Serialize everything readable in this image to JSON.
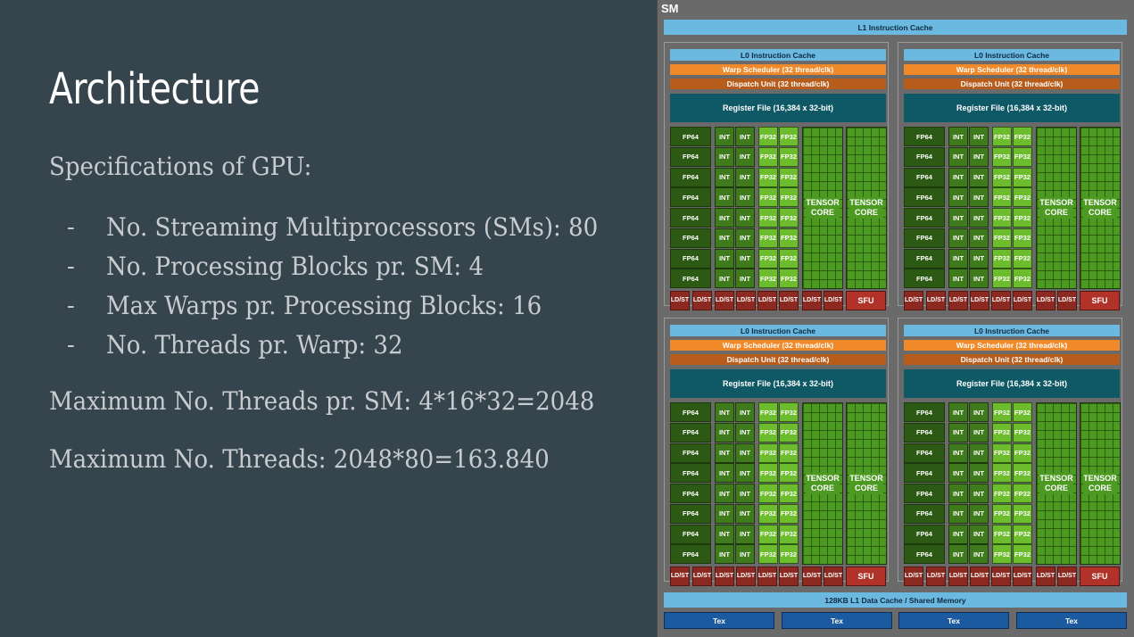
{
  "slide": {
    "title": "Architecture",
    "spec_heading": "Specifications of GPU:",
    "bullets": [
      "No. Streaming Multiprocessors (SMs): 80",
      "No. Processing Blocks pr. SM: 4",
      "Max Warps pr. Processing Blocks: 16",
      "No. Threads pr. Warp: 32"
    ],
    "bullet_marker": "-",
    "max_threads_sm": "Maximum No. Threads pr. SM: 4*16*32=2048",
    "max_threads_total": "Maximum No. Threads: 2048*80=163.840"
  },
  "sm_diagram": {
    "label": "SM",
    "l1_instruction_cache": "L1 Instruction Cache",
    "processing_block": {
      "l0_instruction_cache": "L0 Instruction Cache",
      "warp_scheduler": "Warp Scheduler (32 thread/clk)",
      "dispatch_unit": "Dispatch Unit (32 thread/clk)",
      "register_file": "Register File (16,384 x 32-bit)",
      "fp64": "FP64",
      "int": "INT",
      "fp32": "FP32",
      "tensor_line1": "TENSOR",
      "tensor_line2": "CORE",
      "ldst_line1": "LD/",
      "ldst_line2": "ST",
      "sfu": "SFU"
    },
    "l1_data_cache": "128KB L1 Data Cache / Shared Memory",
    "tex": [
      "Tex",
      "Tex",
      "Tex",
      "Tex"
    ],
    "colors": {
      "background": "#36454d",
      "cache": "#6bb8e0",
      "warp_scheduler": "#f0892a",
      "dispatch_unit": "#b85c1c",
      "register_file": "#0f5966",
      "fp64": "#2c5a14",
      "int": "#3f7a1c",
      "fp32": "#6cbc2e",
      "tensor": "#4c9a22",
      "ldst": "#8c2a22",
      "sfu": "#b03228",
      "tex": "#1c5aa0"
    }
  }
}
